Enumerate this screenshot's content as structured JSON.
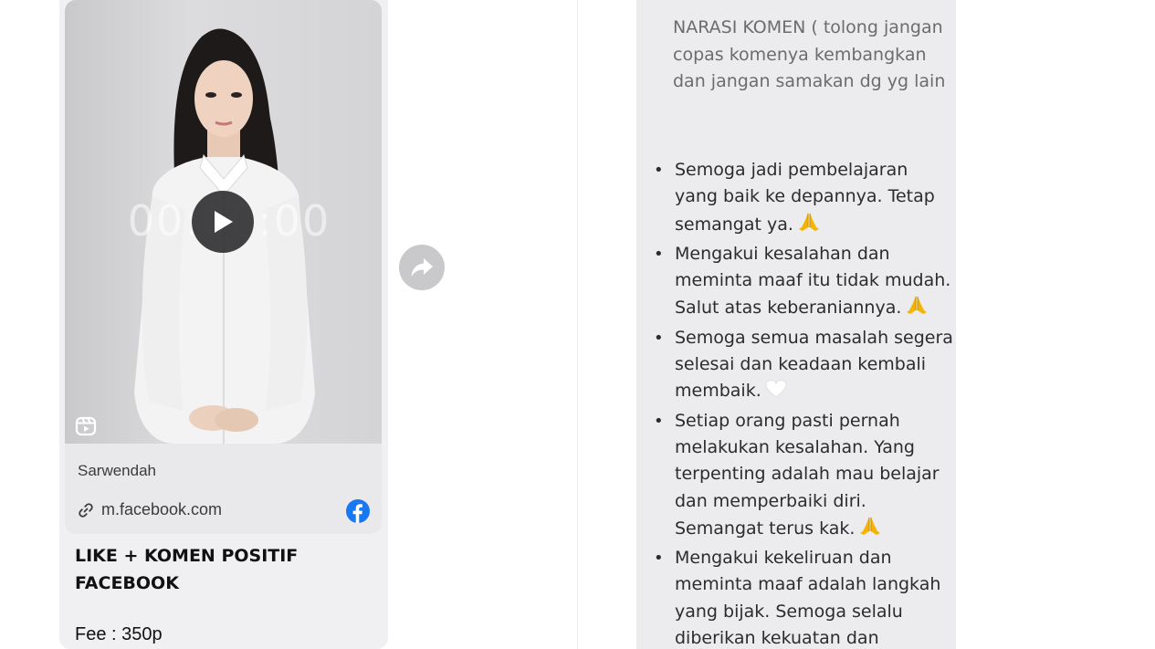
{
  "post": {
    "video_timecode": "00:00:00",
    "source_name": "Sarwendah",
    "link_url": "m.facebook.com",
    "title": "LIKE + KOMEN POSITIF FACEBOOK",
    "fee": "Fee : 350p"
  },
  "message": {
    "header": "NARASI KOMEN ( tolong jangan copas komenya kembangkan dan jangan samakan dg yg lain",
    "comments": [
      {
        "text": "Semoga jadi pembelajaran yang baik ke depannya. Tetap semangat ya.",
        "emoji": "pray-emoji"
      },
      {
        "text": "Mengakui kesalahan dan meminta maaf itu tidak mudah. Salut atas keberaniannya.",
        "emoji": "pray-emoji"
      },
      {
        "text": "Semoga semua masalah segera selesai dan keadaan kembali membaik.",
        "emoji": "white-heart-emoji"
      },
      {
        "text": "Setiap orang pasti pernah melakukan kesalahan. Yang terpenting adalah mau belajar dan memperbaiki diri. Semangat terus kak.",
        "emoji": "pray-emoji"
      },
      {
        "text": "Mengakui kekeliruan dan meminta maaf adalah langkah yang bijak. Semoga selalu diberikan kekuatan dan",
        "emoji": ""
      }
    ]
  },
  "colors": {
    "facebook_blue": "#1877f2",
    "emoji_gold": "#f5b400"
  },
  "icons": {
    "play": "play-icon",
    "reels": "reels-icon",
    "link": "link-icon",
    "facebook": "facebook-logo-icon",
    "share": "share-arrow-icon"
  }
}
